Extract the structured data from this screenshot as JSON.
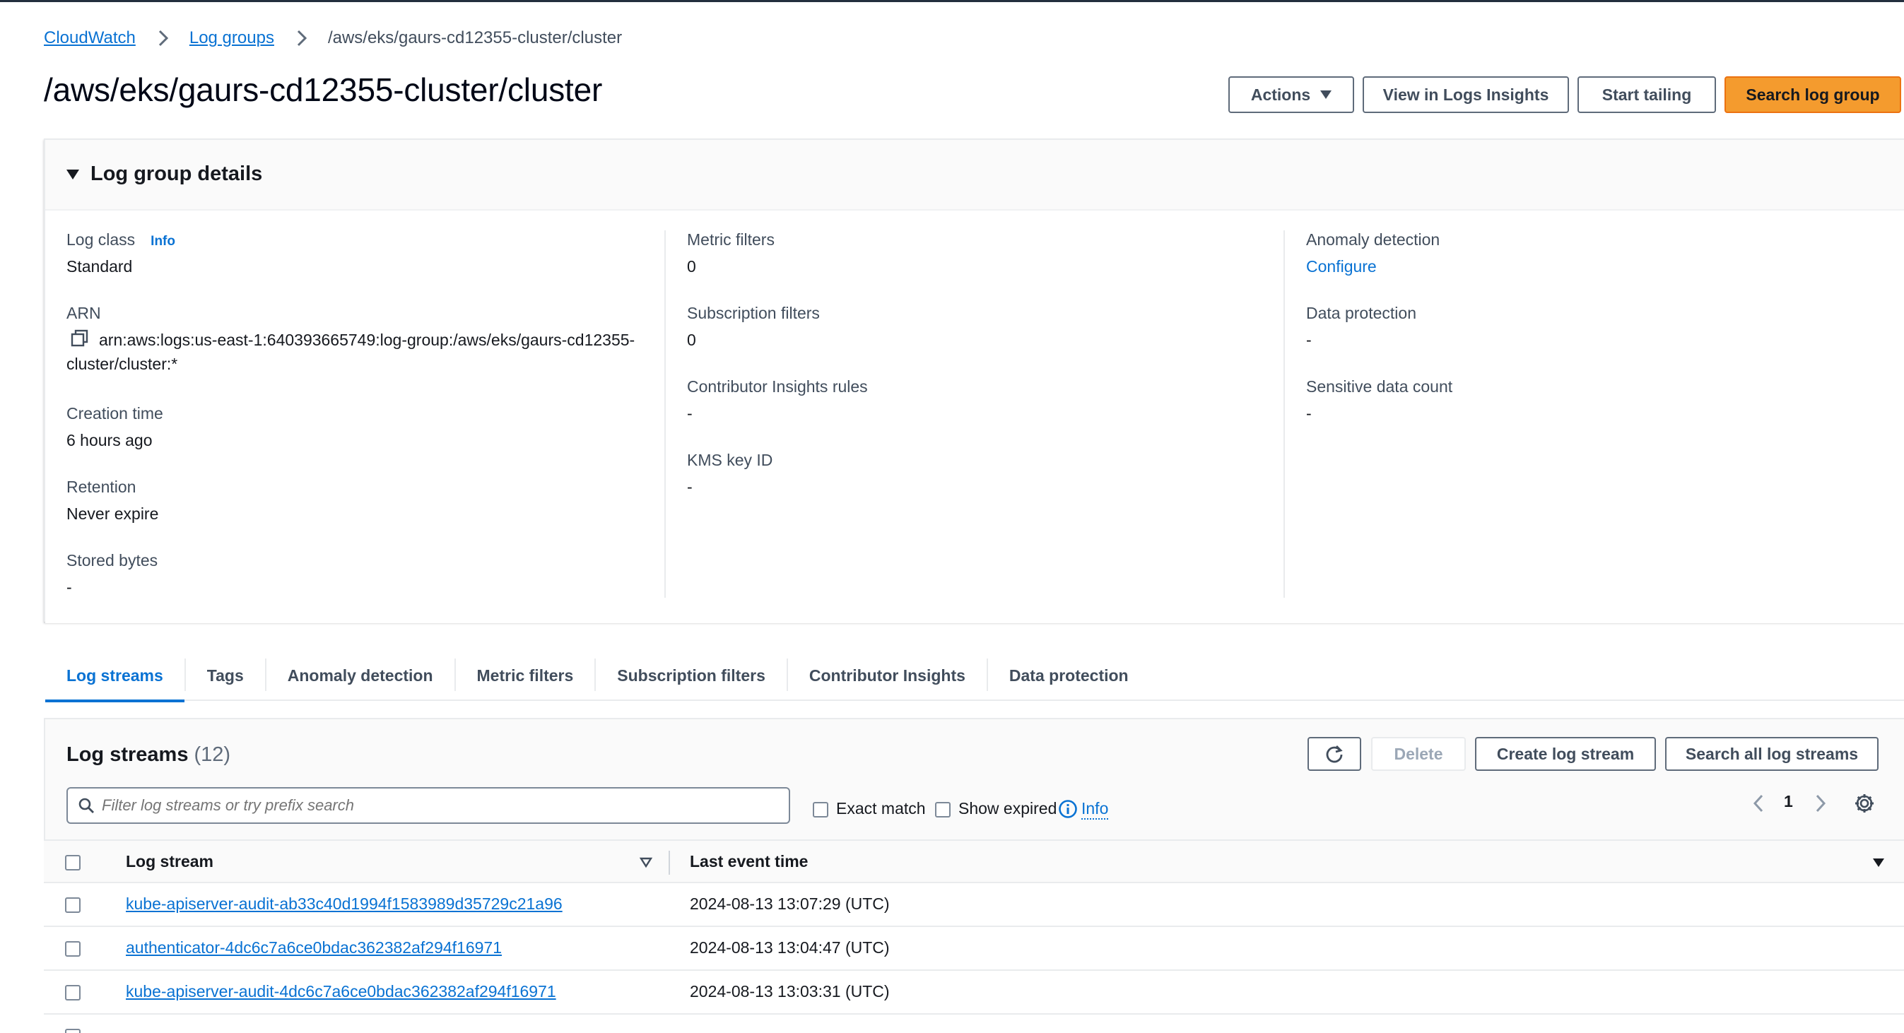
{
  "breadcrumb": {
    "items": [
      "CloudWatch",
      "Log groups"
    ],
    "current": "/aws/eks/gaurs-cd12355-cluster/cluster"
  },
  "page": {
    "title": "/aws/eks/gaurs-cd12355-cluster/cluster"
  },
  "actions": {
    "actions_label": "Actions",
    "view_insights_label": "View in Logs Insights",
    "start_tailing_label": "Start tailing",
    "search_log_group_label": "Search log group"
  },
  "details": {
    "title": "Log group details",
    "info_label": "Info",
    "col1": [
      {
        "label": "Log class",
        "value": "Standard"
      },
      {
        "label": "ARN",
        "value": "arn:aws:logs:us-east-1:640393665749:log-group:/aws/eks/gaurs-cd12355-cluster/cluster:*"
      },
      {
        "label": "Creation time",
        "value": "6 hours ago"
      },
      {
        "label": "Retention",
        "value": "Never expire"
      },
      {
        "label": "Stored bytes",
        "value": "-"
      }
    ],
    "col2": [
      {
        "label": "Metric filters",
        "value": "0"
      },
      {
        "label": "Subscription filters",
        "value": "0"
      },
      {
        "label": "Contributor Insights rules",
        "value": "-"
      },
      {
        "label": "KMS key ID",
        "value": "-"
      }
    ],
    "col3": [
      {
        "label": "Anomaly detection",
        "value": "Configure"
      },
      {
        "label": "Data protection",
        "value": "-"
      },
      {
        "label": "Sensitive data count",
        "value": "-"
      }
    ]
  },
  "tabs": [
    "Log streams",
    "Tags",
    "Anomaly detection",
    "Metric filters",
    "Subscription filters",
    "Contributor Insights",
    "Data protection"
  ],
  "streams": {
    "title": "Log streams",
    "count": "(12)",
    "delete_label": "Delete",
    "create_label": "Create log stream",
    "search_all_label": "Search all log streams",
    "search_placeholder": "Filter log streams or try prefix search",
    "exact_match_label": "Exact match",
    "show_expired_label": "Show expired",
    "info_label": "Info",
    "page": "1",
    "columns": [
      "Log stream",
      "Last event time"
    ],
    "rows": [
      {
        "name": "kube-apiserver-audit-ab33c40d1994f1583989d35729c21a96",
        "time": "2024-08-13 13:07:29 (UTC)"
      },
      {
        "name": "authenticator-4dc6c7a6ce0bdac362382af294f16971",
        "time": "2024-08-13 13:04:47 (UTC)"
      },
      {
        "name": "kube-apiserver-audit-4dc6c7a6ce0bdac362382af294f16971",
        "time": "2024-08-13 13:03:31 (UTC)"
      }
    ]
  },
  "colors": {
    "link": "#0972d3",
    "primary_button": "#f49b2e",
    "text": "#16191f",
    "muted": "#414d5c"
  }
}
